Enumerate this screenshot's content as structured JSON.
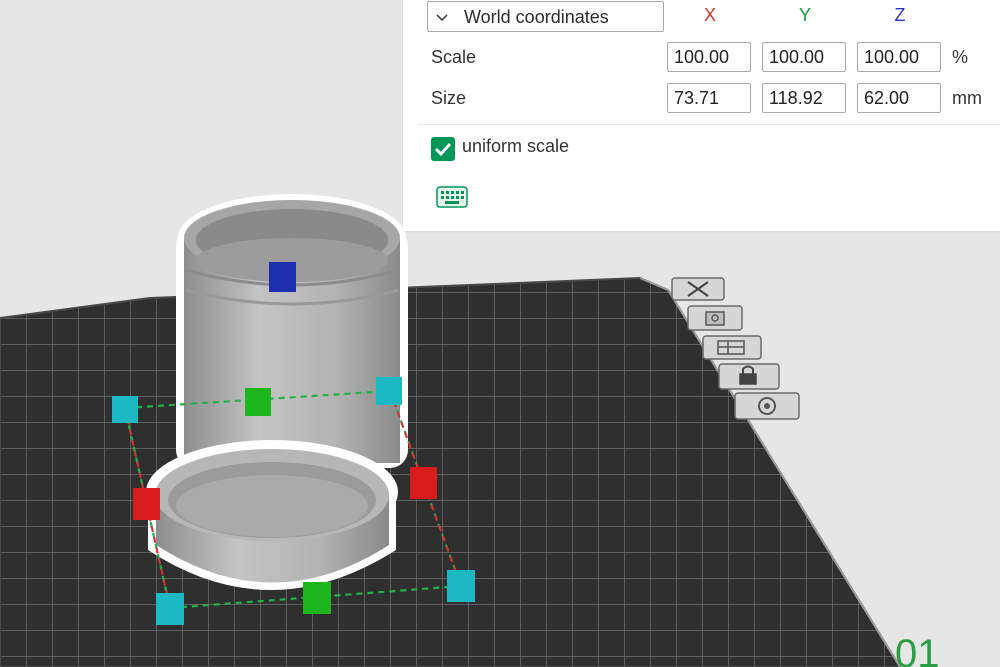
{
  "panel": {
    "coordinate_system": "World coordinates",
    "axes": {
      "x": "X",
      "y": "Y",
      "z": "Z"
    },
    "colors": {
      "x": "#e0302a",
      "y": "#179a3c",
      "z": "#2732d6",
      "accent": "#009655"
    },
    "scale": {
      "label": "Scale",
      "x": "100.00",
      "y": "100.00",
      "z": "100.00",
      "unit": "%"
    },
    "size": {
      "label": "Size",
      "x": "73.71",
      "y": "118.92",
      "z": "62.00",
      "unit": "mm"
    },
    "uniform_scale": {
      "label": "uniform scale",
      "checked": true
    },
    "keyboard_icon": "keyboard-icon"
  },
  "toolbar_icons": [
    "delete-icon",
    "camera-icon",
    "layout-icon",
    "lock-icon",
    "settings-icon"
  ]
}
